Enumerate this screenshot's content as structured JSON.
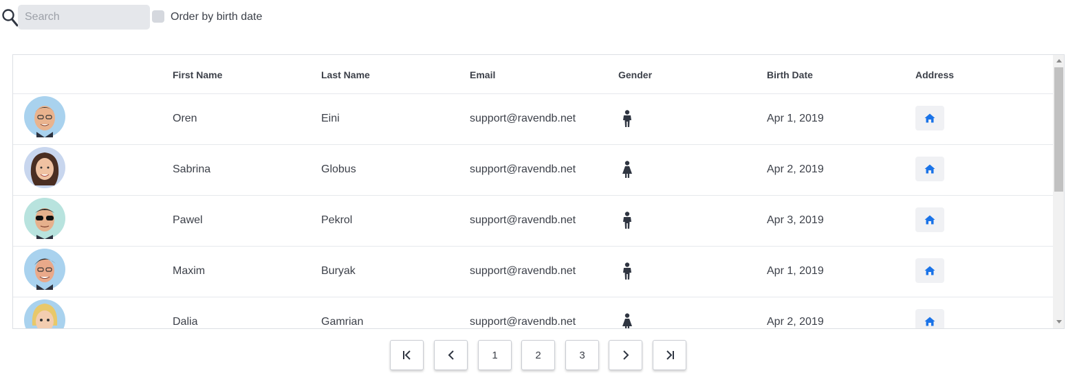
{
  "toolbar": {
    "search_placeholder": "Search",
    "search_value": "",
    "order_label": "Order by birth date",
    "order_checked": false
  },
  "table": {
    "headers": {
      "first_name": "First Name",
      "last_name": "Last Name",
      "email": "Email",
      "gender": "Gender",
      "birth_date": "Birth Date",
      "address": "Address"
    },
    "rows": [
      {
        "first_name": "Oren",
        "last_name": "Eini",
        "email": "support@ravendb.net",
        "gender": "male-icon",
        "birth_date": "Apr 1, 2019",
        "address_icon": "home-icon"
      },
      {
        "first_name": "Sabrina",
        "last_name": "Globus",
        "email": "support@ravendb.net",
        "gender": "female-icon",
        "birth_date": "Apr 2, 2019",
        "address_icon": "home-icon"
      },
      {
        "first_name": "Pawel",
        "last_name": "Pekrol",
        "email": "support@ravendb.net",
        "gender": "male-icon",
        "birth_date": "Apr 3, 2019",
        "address_icon": "home-icon"
      },
      {
        "first_name": "Maxim",
        "last_name": "Buryak",
        "email": "support@ravendb.net",
        "gender": "male-icon",
        "birth_date": "Apr 1, 2019",
        "address_icon": "home-icon"
      },
      {
        "first_name": "Dalia",
        "last_name": "Gamrian",
        "email": "support@ravendb.net",
        "gender": "female-icon",
        "birth_date": "Apr 2, 2019",
        "address_icon": "home-icon"
      }
    ]
  },
  "pagination": {
    "first_icon": "first-page-icon",
    "prev_icon": "chevron-left-icon",
    "pages": [
      "1",
      "2",
      "3"
    ],
    "next_icon": "chevron-right-icon",
    "last_icon": "last-page-icon"
  },
  "colors": {
    "text": "#3c4049",
    "icon_dark": "#2f3541",
    "accent_blue": "#1a73e8",
    "search_bg": "#e5e7eb",
    "address_btn_bg": "#f0f1f4"
  }
}
